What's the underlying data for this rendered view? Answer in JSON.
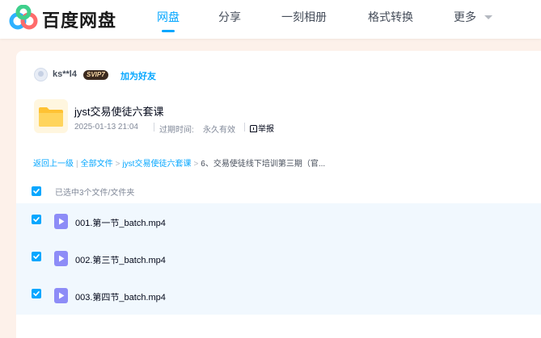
{
  "app": {
    "brand_name": "百度网盘",
    "accent_color": "#06a7ff"
  },
  "nav": {
    "items": [
      {
        "label": "网盘",
        "active": true
      },
      {
        "label": "分享",
        "active": false
      },
      {
        "label": "一刻相册",
        "active": false
      },
      {
        "label": "格式转换",
        "active": false
      },
      {
        "label": "更多",
        "active": false
      }
    ],
    "more_icon": "chevron-down-icon"
  },
  "sharer": {
    "username": "ks**l4",
    "vip_badge": "SVIP7",
    "add_friend_label": "加为好友"
  },
  "share": {
    "title": "jyst交易使徒六套课",
    "date": "2025-01-13 21:04",
    "expiry_label": "过期时间:",
    "expiry_value": "永久有效",
    "report_label": "举报",
    "icon": "folder-icon"
  },
  "breadcrumb": {
    "items": [
      {
        "label": "返回上一级",
        "link": true
      },
      {
        "label": "全部文件",
        "link": true
      },
      {
        "label": "jyst交易使徒六套课",
        "link": true
      },
      {
        "label": "6、交易使徒线下培训第三期（官...",
        "link": false
      }
    ],
    "separators": [
      "|",
      ">",
      ">"
    ]
  },
  "selection": {
    "summary": "已选中3个文件/文件夹",
    "all_checked": true
  },
  "files": [
    {
      "name": "001.第一节_batch.mp4",
      "checked": true,
      "icon": "video-file-icon"
    },
    {
      "name": "002.第三节_batch.mp4",
      "checked": true,
      "icon": "video-file-icon"
    },
    {
      "name": "003.第四节_batch.mp4",
      "checked": true,
      "icon": "video-file-icon"
    }
  ]
}
